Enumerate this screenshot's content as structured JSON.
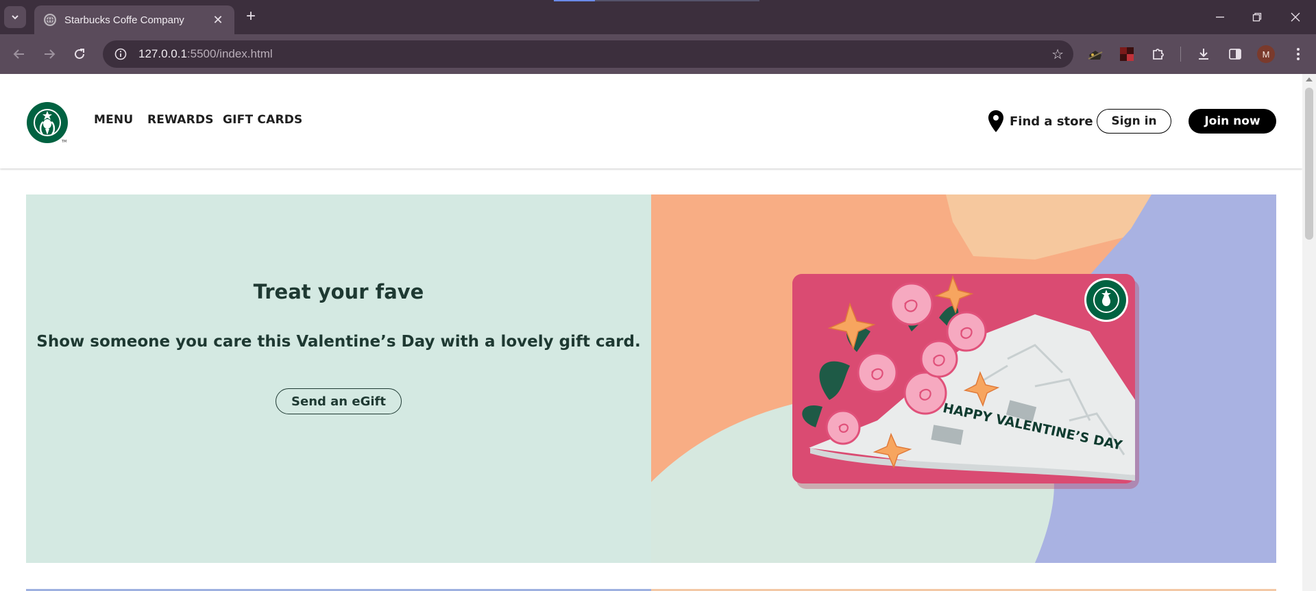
{
  "browser": {
    "tab_title": "Starbucks Coffe Company",
    "url_host": "127.0.0.1",
    "url_path": ":5500/index.html",
    "profile_initial": "M"
  },
  "header": {
    "nav": [
      "MENU",
      "REWARDS",
      "GIFT CARDS"
    ],
    "find_store": "Find a store",
    "sign_in": "Sign in",
    "join_now": "Join now"
  },
  "hero": {
    "title": "Treat your fave",
    "text": "Show someone you care this Valentine’s Day with a lovely gift card.",
    "button": "Send an eGift",
    "card_text": "HAPPY VALENTINE’S DAY"
  },
  "colors": {
    "brand_green": "#006241",
    "house_green": "#1e3932",
    "hero_left_bg": "#d4e9e2",
    "card_pink": "#d6446b"
  }
}
